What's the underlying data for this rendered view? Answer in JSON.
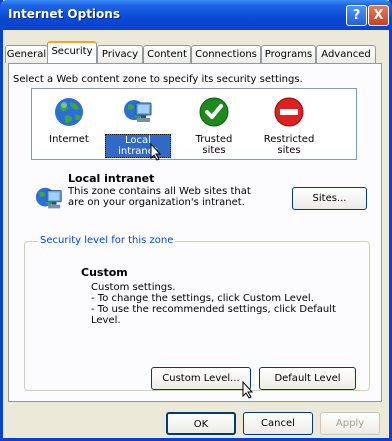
{
  "window": {
    "title": "Internet Options",
    "help": "?",
    "close": "X"
  },
  "tabs": [
    "General",
    "Security",
    "Privacy",
    "Content",
    "Connections",
    "Programs",
    "Advanced"
  ],
  "zone_prompt": "Select a Web content zone to specify its security settings.",
  "zones": [
    {
      "label": "Internet",
      "icon": "globe-icon"
    },
    {
      "label": "Local intranet",
      "icon": "intranet-icon",
      "selected": true
    },
    {
      "label": "Trusted sites",
      "icon": "trusted-check-icon"
    },
    {
      "label": "Restricted sites",
      "label_line1": "Restricted",
      "label_line2": "sites",
      "icon": "restricted-icon"
    }
  ],
  "selected_zone": {
    "name": "Local intranet",
    "description_line1": "This zone contains all Web sites that",
    "description_line2": "are on your organization's intranet.",
    "sites_button": "Sites..."
  },
  "security_level": {
    "legend": "Security level for this zone",
    "title": "Custom",
    "lines": [
      "Custom settings.",
      "- To change the settings, click Custom Level.",
      "- To use the recommended settings, click Default Level."
    ],
    "custom_level_button": "Custom Level...",
    "default_level_button": "Default Level"
  },
  "footer": {
    "ok": "OK",
    "cancel": "Cancel",
    "apply": "Apply"
  },
  "colors": {
    "title_blue": "#0a4ad6",
    "selection": "#316ac5",
    "tab_highlight": "#f5a623",
    "legend_text": "#0046d5"
  }
}
